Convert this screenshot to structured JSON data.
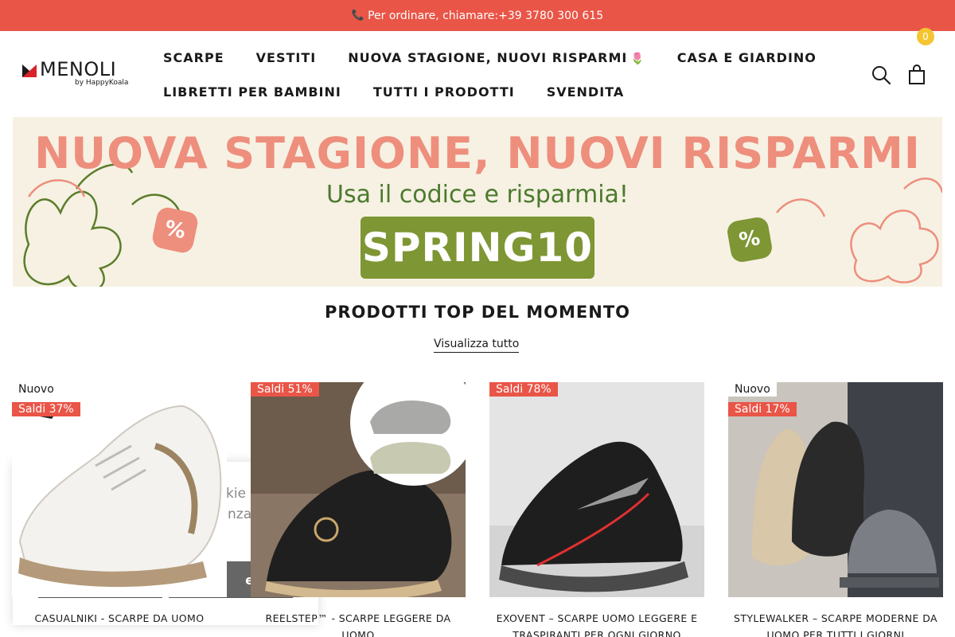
{
  "topbar": {
    "phone_icon": "📞",
    "text": "Per ordinare, chiamare:+39 3780 300 615"
  },
  "logo": {
    "name": "MENOLI",
    "sub": "by HappyKoala"
  },
  "nav": {
    "items": [
      {
        "label": "SCARPE"
      },
      {
        "label": "VESTITI"
      },
      {
        "label": "NUOVA STAGIONE, NUOVI RISPARMI",
        "emoji": "🌷"
      },
      {
        "label": "CASA E GIARDINO"
      },
      {
        "label": "LIBRETTI PER BAMBINI"
      },
      {
        "label": "TUTTI I PRODOTTI"
      },
      {
        "label": "SVENDITA"
      }
    ]
  },
  "header": {
    "cart_count": "0",
    "search_icon": "search-icon",
    "cart_icon": "bag-icon"
  },
  "banner": {
    "title": "NUOVA STAGIONE, NUOVI RISPARMI",
    "subtitle": "Usa il codice e risparmia!",
    "code": "SPRING10",
    "pct_symbol": "%"
  },
  "section": {
    "title": "PRODOTTI TOP DEL MOMENTO",
    "view_all": "Visualizza tutto"
  },
  "products": [
    {
      "badge_new": "Nuovo",
      "badge_sale": "Saldi 37%",
      "name": "CASUALNIKI - SCARPE DA UOMO"
    },
    {
      "badge_new": "",
      "badge_sale": "Saldi 51%",
      "name": "REELSTEP™ - SCARPE LEGGERE DA UOMO"
    },
    {
      "badge_new": "",
      "badge_sale": "Saldi 78%",
      "name": "EXOVENT – SCARPE UOMO LEGGERE E TRASPIRANTI PER OGNI GIORNO"
    },
    {
      "badge_new": "Nuovo",
      "badge_sale": "Saldi 17%",
      "name": "STYLEWALKER – SCARPE MODERNE DA UOMO PER TUTTI I GIORNI"
    }
  ],
  "cookie": {
    "text_line1": "kie p",
    "text_line2": "nza",
    "accept": "ettar"
  },
  "colors": {
    "accent": "#e95547",
    "badge": "#f5c531",
    "banner_bg": "#f6f1e3",
    "code_bg": "#7e9634"
  }
}
